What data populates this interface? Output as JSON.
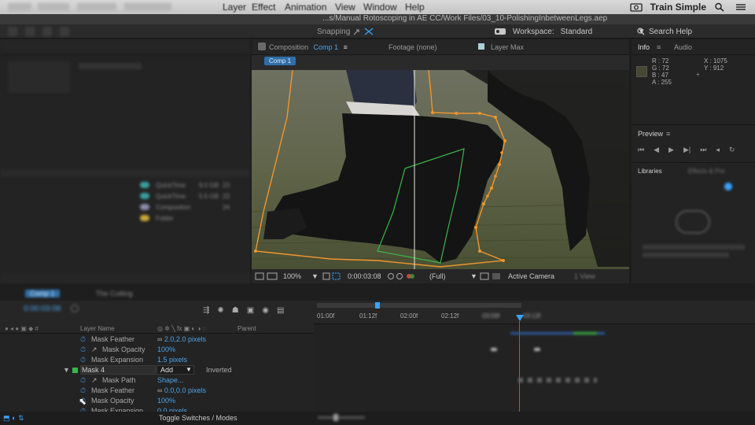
{
  "menubar": {
    "items": [
      "Layer",
      "Effect",
      "Animation",
      "View",
      "Window",
      "Help"
    ],
    "brand": "Train Simple"
  },
  "titlebar": {
    "path": "...s/Manual Rotoscoping in AE CC/Work Files/03_10-PolishingInbetweenLegs.aep"
  },
  "toolbar": {
    "snapping": "Snapping",
    "workspace_label": "Workspace:",
    "workspace_value": "Standard",
    "search": "Search Help"
  },
  "project": {
    "rows": [
      {
        "type": "QuickTime",
        "size": "9.0 GB",
        "fps": "23"
      },
      {
        "type": "QuickTime",
        "size": "5.5 GB",
        "fps": "23"
      },
      {
        "type": "Composition",
        "size": "",
        "fps": "24"
      },
      {
        "type": "Folder",
        "size": "",
        "fps": ""
      }
    ]
  },
  "comp_panel": {
    "tab_comp_prefix": "Composition",
    "tab_comp_name": "Comp 1",
    "tab_footage": "Footage (none)",
    "tab_layer": "Layer Max",
    "badge": "Comp 1"
  },
  "viewer_bar": {
    "zoom": "100%",
    "timecode": "0:00:03:08",
    "resolution": "(Full)",
    "camera": "Active Camera",
    "view": "1 View"
  },
  "info": {
    "tab_info": "Info",
    "tab_audio": "Audio",
    "r": "R : 72",
    "g": "G : 72",
    "b": "B : 47",
    "a": "A : 255",
    "x": "X : 1075",
    "y": "Y : 912"
  },
  "preview": {
    "title": "Preview"
  },
  "libraries": {
    "title": "Libraries",
    "tab2": "Effects & Pre"
  },
  "timeline": {
    "tab_active": "Comp 1",
    "tab_other": "The Cutting",
    "timecode": "0:00:03:08",
    "col_layer_name": "Layer Name",
    "col_parent": "Parent",
    "ruler": [
      "01:00f",
      "01:12f",
      "02:00f",
      "02:12f",
      "03:00f",
      "03:12f"
    ],
    "rows": [
      {
        "name": "Mask Feather",
        "value": "2.0,2.0 pixels"
      },
      {
        "name": "Mask Opacity",
        "value": "100%"
      },
      {
        "name": "Mask Expansion",
        "value": "1.5 pixels"
      },
      {
        "name": "Mask 4",
        "mode": "Add",
        "inverted": "Inverted"
      },
      {
        "name": "Mask Path",
        "value": "Shape..."
      },
      {
        "name": "Mask Feather",
        "value": "0.0,0.0 pixels"
      },
      {
        "name": "Mask Opacity",
        "value": "100%"
      },
      {
        "name": "Mask Expansion",
        "value": "0.0 pixels"
      }
    ],
    "footer_toggle": "Toggle Switches / Modes"
  },
  "colors": {
    "accent_blue": "#4da3e8",
    "mask_orange": "#f0962e",
    "mask_green": "#3ab54a",
    "playhead": "#3aa3ff"
  }
}
